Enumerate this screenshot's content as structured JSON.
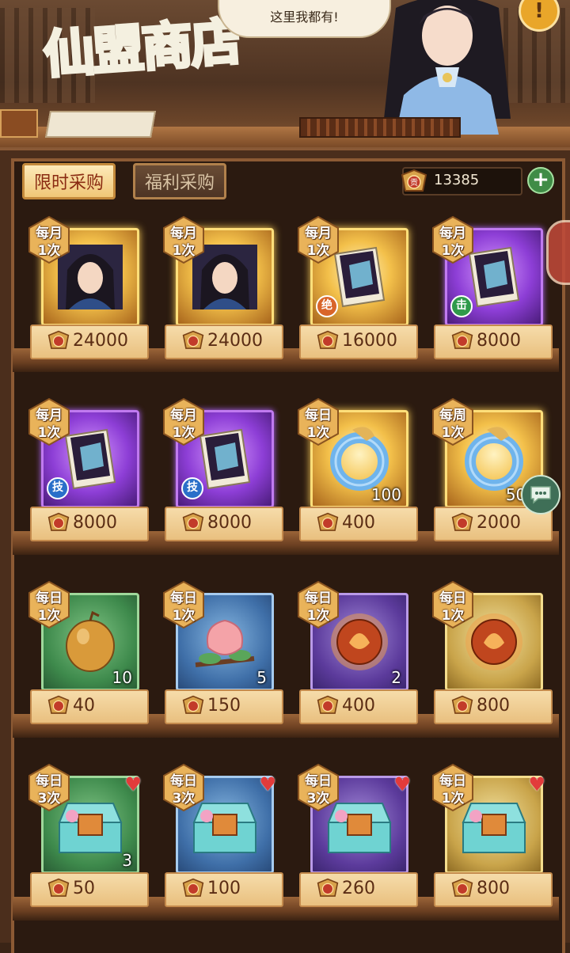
{
  "header": {
    "title": "仙盟商店",
    "speech": "这里我都有!",
    "help_label": "!"
  },
  "tabs": [
    {
      "label": "限时采购",
      "active": true
    },
    {
      "label": "福利采购",
      "active": false
    }
  ],
  "currency": {
    "amount": "13385",
    "add_label": "+"
  },
  "rows": [
    [
      {
        "limit_period": "每月",
        "limit_count": "1次",
        "price": "24000",
        "qty": "",
        "frame": "gold",
        "icon": "hero-portrait-icon",
        "skill": ""
      },
      {
        "limit_period": "每月",
        "limit_count": "1次",
        "price": "24000",
        "qty": "",
        "frame": "gold",
        "icon": "hero-portrait-icon",
        "skill": ""
      },
      {
        "limit_period": "每月",
        "limit_count": "1次",
        "price": "16000",
        "qty": "",
        "frame": "gold",
        "icon": "skill-book-icon",
        "skill": "绝"
      },
      {
        "limit_period": "每月",
        "limit_count": "1次",
        "price": "8000",
        "qty": "",
        "frame": "purple",
        "icon": "skill-book-icon",
        "skill": "击"
      }
    ],
    [
      {
        "limit_period": "每月",
        "limit_count": "1次",
        "price": "8000",
        "qty": "",
        "frame": "purple",
        "icon": "skill-book-icon",
        "skill": "技"
      },
      {
        "limit_period": "每月",
        "limit_count": "1次",
        "price": "8000",
        "qty": "",
        "frame": "purple",
        "icon": "skill-book-icon",
        "skill": "技"
      },
      {
        "limit_period": "每日",
        "limit_count": "1次",
        "price": "400",
        "qty": "100",
        "frame": "gold",
        "icon": "jade-ring-icon",
        "skill": ""
      },
      {
        "limit_period": "每周",
        "limit_count": "1次",
        "price": "2000",
        "qty": "500",
        "frame": "gold",
        "icon": "jade-ring-icon",
        "skill": ""
      }
    ],
    [
      {
        "limit_period": "每日",
        "limit_count": "1次",
        "price": "40",
        "qty": "10",
        "frame": "green",
        "icon": "fruit-icon",
        "skill": ""
      },
      {
        "limit_period": "每日",
        "limit_count": "1次",
        "price": "150",
        "qty": "5",
        "frame": "blue",
        "icon": "peach-icon",
        "skill": ""
      },
      {
        "limit_period": "每日",
        "limit_count": "1次",
        "price": "400",
        "qty": "2",
        "frame": "violet",
        "icon": "fire-orb-icon",
        "skill": ""
      },
      {
        "limit_period": "每日",
        "limit_count": "1次",
        "price": "800",
        "qty": "",
        "frame": "yellow",
        "icon": "fire-orb-icon",
        "skill": ""
      }
    ],
    [
      {
        "limit_period": "每日",
        "limit_count": "3次",
        "price": "50",
        "qty": "3",
        "frame": "green",
        "icon": "treasure-chest-icon",
        "skill": ""
      },
      {
        "limit_period": "每日",
        "limit_count": "3次",
        "price": "100",
        "qty": "",
        "frame": "blue",
        "icon": "treasure-chest-icon",
        "skill": ""
      },
      {
        "limit_period": "每日",
        "limit_count": "3次",
        "price": "260",
        "qty": "",
        "frame": "violet",
        "icon": "treasure-chest-icon",
        "skill": ""
      },
      {
        "limit_period": "每日",
        "limit_count": "1次",
        "price": "800",
        "qty": "",
        "frame": "yellow",
        "icon": "treasure-chest-icon",
        "skill": ""
      }
    ]
  ],
  "colors": {
    "accent": "#f0c777",
    "wood": "#8c5a34",
    "price_text": "#5b2d14"
  }
}
